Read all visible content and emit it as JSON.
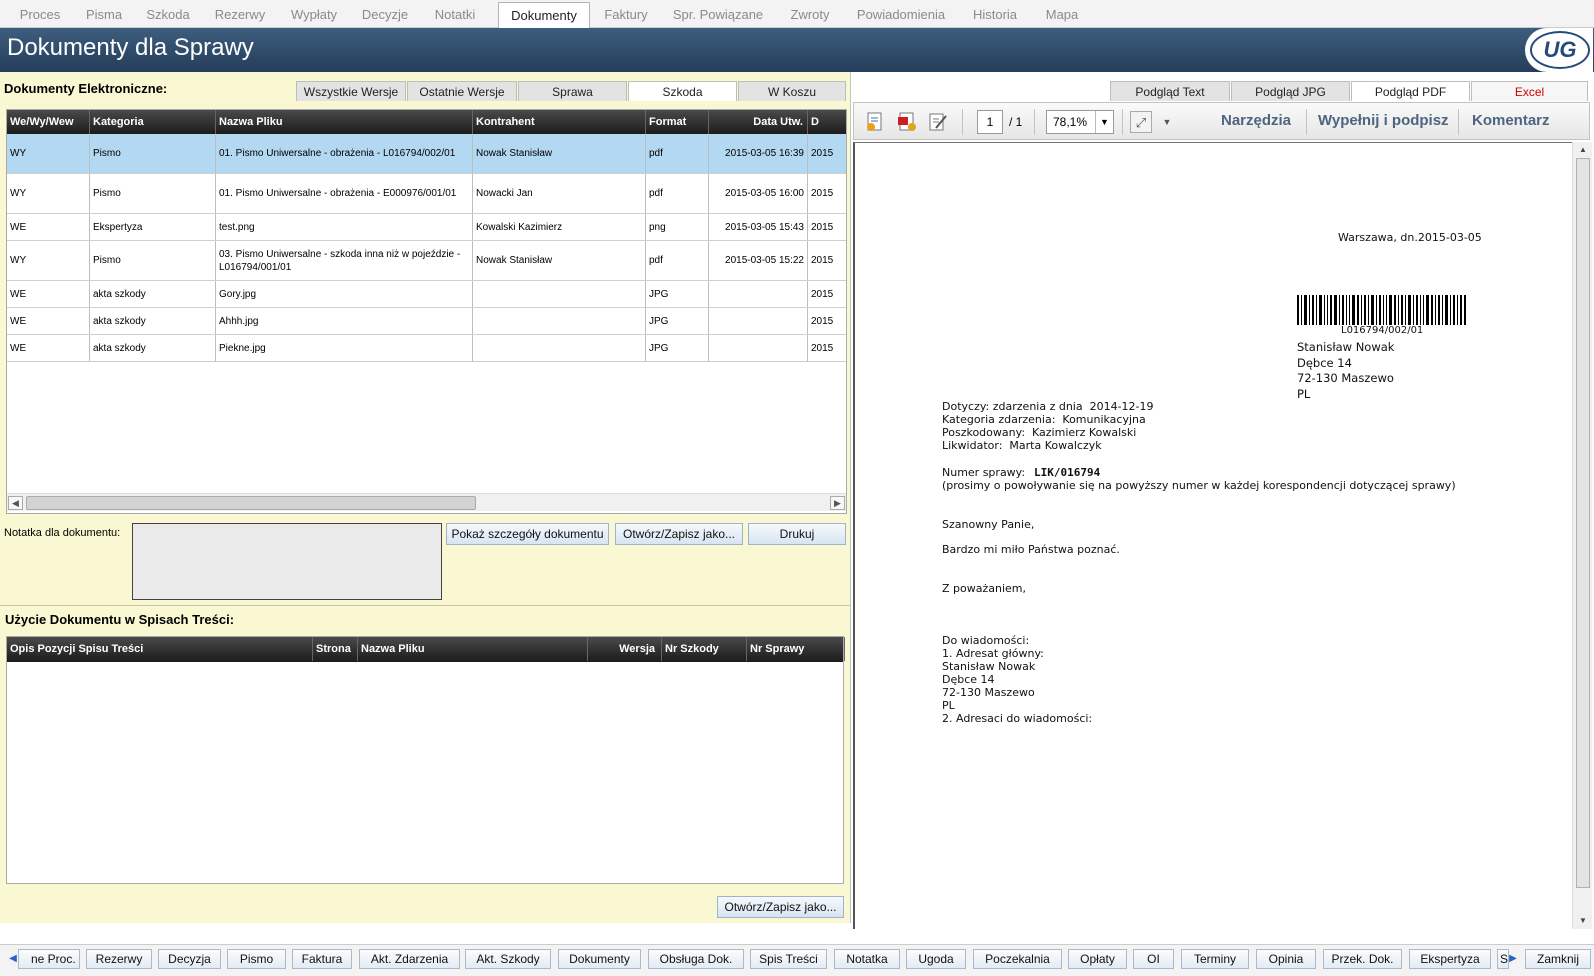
{
  "top_tabs": [
    "Proces",
    "Pisma",
    "Szkoda",
    "Rezerwy",
    "Wypłaty",
    "Decyzje",
    "Notatki",
    "Dokumenty",
    "Faktury",
    "Spr. Powiązane",
    "Zwroty",
    "Powiadomienia",
    "Historia",
    "Mapa"
  ],
  "active_top_tab": "Dokumenty",
  "page_title": "Dokumenty dla Sprawy",
  "logo_text": "UG",
  "left": {
    "section_title": "Dokumenty Elektroniczne:",
    "sub_tabs": [
      "Wszystkie Wersje",
      "Ostatnie Wersje",
      "Sprawa",
      "Szkoda",
      "W Koszu"
    ],
    "active_sub_tab": "Szkoda",
    "table": {
      "columns": [
        "We/Wy/Wew",
        "Kategoria",
        "Nazwa Pliku",
        "Kontrahent",
        "Format",
        "Data Utw.",
        "D"
      ],
      "rows": [
        [
          "WY",
          "Pismo",
          "01. Pismo Uniwersalne - obrażenia - L016794/002/01",
          "Nowak Stanisław",
          "pdf",
          "2015-03-05 16:39",
          "2015"
        ],
        [
          "WY",
          "Pismo",
          "01. Pismo Uniwersalne - obrażenia - E000976/001/01",
          "Nowacki Jan",
          "pdf",
          "2015-03-05 16:00",
          "2015"
        ],
        [
          "WE",
          "Ekspertyza",
          "test.png",
          "Kowalski Kazimierz",
          "png",
          "2015-03-05 15:43",
          "2015"
        ],
        [
          "WY",
          "Pismo",
          "03. Pismo Uniwersalne - szkoda inna niż w pojeździe - L016794/001/01",
          "Nowak Stanisław",
          "pdf",
          "2015-03-05 15:22",
          "2015"
        ],
        [
          "WE",
          "akta szkody",
          "Gory.jpg",
          "",
          "JPG",
          "",
          "2015"
        ],
        [
          "WE",
          "akta szkody",
          "Ahhh.jpg",
          "",
          "JPG",
          "",
          "2015"
        ],
        [
          "WE",
          "akta szkody",
          "Piekne.jpg",
          "",
          "JPG",
          "",
          "2015"
        ]
      ]
    },
    "note_label": "Notatka dla dokumentu:",
    "note_value": "",
    "buttons": {
      "details": "Pokaż szczegóły dokumentu",
      "open_save": "Otwórz/Zapisz jako...",
      "print": "Drukuj"
    },
    "usage_title": "Użycie Dokumentu w Spisach Treści:",
    "usage_columns": [
      "Opis Pozycji Spisu Treści",
      "Strona",
      "Nazwa Pliku",
      "Wersja",
      "Nr Szkody",
      "Nr Sprawy"
    ],
    "usage_button": "Otwórz/Zapisz jako..."
  },
  "right": {
    "tabs": [
      "Podgląd Text",
      "Podgląd JPG",
      "Podgląd PDF",
      "Excel"
    ],
    "active_tab": "Podgląd PDF",
    "toolbar": {
      "page": "1",
      "page_total": "/ 1",
      "zoom": "78,1%",
      "tools": "Narzędzia",
      "fill_sign": "Wypełnij i podpisz",
      "comment": "Komentarz"
    },
    "document": {
      "date_line": "Warszawa, dn.2015-03-05",
      "barcode_text": "L016794/002/01",
      "address": "Stanisław Nowak\nDębce 14\n72-130 Maszewo\nPL",
      "details": "Dotyczy: zdarzenia z dnia  2014-12-19\nKategoria zdarzenia:  Komunikacyjna\nPoszkodowany:  Kazimierz Kowalski\nLikwidator:  Marta Kowalczyk",
      "case_label": "Numer sprawy:",
      "case_number": "LIK/016794",
      "case_note": "(prosimy o powoływanie się na powyższy numer w każdej korespondencji dotyczącej sprawy)",
      "greeting": "Szanowny Panie,",
      "body": "Bardzo mi miło Państwa poznać.",
      "closing": "Z poważaniem,",
      "cc": "Do wiadomości:\n1. Adresat główny:\nStanisław Nowak\nDębce 14\n72-130 Maszewo\nPL\n2. Adresaci do wiadomości:"
    }
  },
  "bottom_buttons": [
    "ne Proc.",
    "Rezerwy",
    "Decyzja",
    "Pismo",
    "Faktura",
    "Akt. Zdarzenia",
    "Akt. Szkody",
    "Dokumenty",
    "Obsługa Dok.",
    "Spis Treści",
    "Notatka",
    "Ugoda",
    "Poczekalnia",
    "Opłaty",
    "OI",
    "Terminy",
    "Opinia",
    "Przek. Dok.",
    "Ekspertyza",
    "S"
  ],
  "close_button": "Zamknij",
  "icons": [
    "save-pdf-icon",
    "pdf-export-icon",
    "edit-icon",
    "expand-icon",
    "chevron-down-icon",
    "arrow-left-icon",
    "arrow-right-icon"
  ]
}
